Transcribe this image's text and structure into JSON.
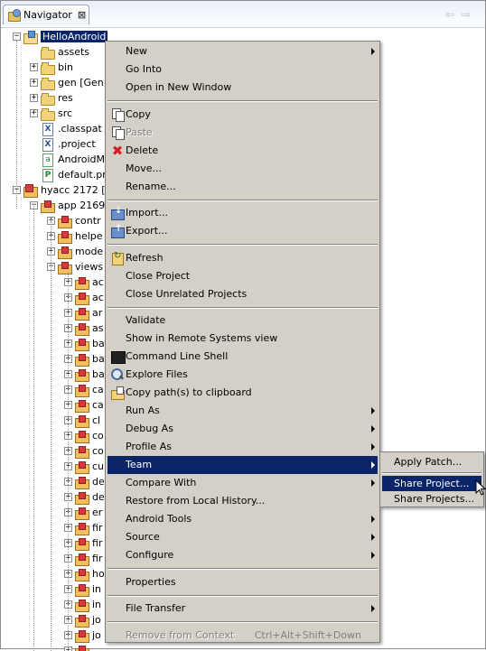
{
  "view": {
    "tab_label": "Navigator",
    "close_glyph": "⊠",
    "nav_arrows": "⇦⇨"
  },
  "tree": [
    {
      "label": "HelloAndroid",
      "icon": "proj",
      "level": 0,
      "toggle": "−",
      "selected": true
    },
    {
      "label": "assets",
      "icon": "folder",
      "level": 1,
      "toggle": ""
    },
    {
      "label": "bin",
      "icon": "folder",
      "level": 1,
      "toggle": "+"
    },
    {
      "label": "gen [Gen",
      "icon": "folder",
      "level": 1,
      "toggle": "+"
    },
    {
      "label": "res",
      "icon": "folder",
      "level": 1,
      "toggle": "+"
    },
    {
      "label": "src",
      "icon": "folder",
      "level": 1,
      "toggle": "+"
    },
    {
      "label": ".classpat",
      "icon": "xfile",
      "level": 1,
      "toggle": ""
    },
    {
      "label": ".project",
      "icon": "xfile",
      "level": 1,
      "toggle": ""
    },
    {
      "label": "AndroidM",
      "icon": "afile",
      "level": 1,
      "toggle": ""
    },
    {
      "label": "default.pr",
      "icon": "pfile",
      "level": 1,
      "toggle": ""
    },
    {
      "label": "hyacc 2172 [",
      "icon": "proj2",
      "level": 0,
      "toggle": "−"
    },
    {
      "label": "app 2169",
      "icon": "pkg",
      "level": 1,
      "toggle": "−"
    },
    {
      "label": "contr",
      "icon": "pkg",
      "level": 2,
      "toggle": "+"
    },
    {
      "label": "helpe",
      "icon": "pkg",
      "level": 2,
      "toggle": "+"
    },
    {
      "label": "mode",
      "icon": "pkg",
      "level": 2,
      "toggle": "+"
    },
    {
      "label": "views",
      "icon": "pkg",
      "level": 2,
      "toggle": "−"
    },
    {
      "label": "ac",
      "icon": "pkg",
      "level": 3,
      "toggle": "+"
    },
    {
      "label": "ac",
      "icon": "pkg",
      "level": 3,
      "toggle": "+"
    },
    {
      "label": "ar",
      "icon": "pkg",
      "level": 3,
      "toggle": "+"
    },
    {
      "label": "as",
      "icon": "pkg",
      "level": 3,
      "toggle": "+"
    },
    {
      "label": "ba",
      "icon": "pkg",
      "level": 3,
      "toggle": "+"
    },
    {
      "label": "ba",
      "icon": "pkg",
      "level": 3,
      "toggle": "+"
    },
    {
      "label": "ba",
      "icon": "pkg",
      "level": 3,
      "toggle": "+"
    },
    {
      "label": "ca",
      "icon": "pkg",
      "level": 3,
      "toggle": "+"
    },
    {
      "label": "ca",
      "icon": "pkg",
      "level": 3,
      "toggle": "+"
    },
    {
      "label": "cl",
      "icon": "pkg",
      "level": 3,
      "toggle": "+"
    },
    {
      "label": "co",
      "icon": "pkg",
      "level": 3,
      "toggle": "+"
    },
    {
      "label": "co",
      "icon": "pkg",
      "level": 3,
      "toggle": "+"
    },
    {
      "label": "cu",
      "icon": "pkg",
      "level": 3,
      "toggle": "+"
    },
    {
      "label": "de",
      "icon": "pkg",
      "level": 3,
      "toggle": "+"
    },
    {
      "label": "de",
      "icon": "pkg",
      "level": 3,
      "toggle": "+"
    },
    {
      "label": "er",
      "icon": "pkg",
      "level": 3,
      "toggle": "+"
    },
    {
      "label": "fir",
      "icon": "pkg",
      "level": 3,
      "toggle": "+"
    },
    {
      "label": "fir",
      "icon": "pkg",
      "level": 3,
      "toggle": "+"
    },
    {
      "label": "fir",
      "icon": "pkg",
      "level": 3,
      "toggle": "+"
    },
    {
      "label": "ho",
      "icon": "pkg",
      "level": 3,
      "toggle": "+"
    },
    {
      "label": "in",
      "icon": "pkg",
      "level": 3,
      "toggle": "+"
    },
    {
      "label": "in",
      "icon": "pkg",
      "level": 3,
      "toggle": "+"
    },
    {
      "label": "jo",
      "icon": "pkg",
      "level": 3,
      "toggle": "+"
    },
    {
      "label": "jo",
      "icon": "pkg",
      "level": 3,
      "toggle": "+"
    },
    {
      "label": "",
      "icon": "pkg",
      "level": 3,
      "toggle": "+"
    }
  ],
  "menu": [
    {
      "type": "item",
      "label": "New",
      "submenu": true,
      "name": "new"
    },
    {
      "type": "item",
      "label": "Go Into",
      "name": "go-into"
    },
    {
      "type": "item",
      "label": "Open in New Window",
      "name": "open-in-new-window"
    },
    {
      "type": "sep"
    },
    {
      "type": "item",
      "label": "Copy",
      "icon": "copy",
      "name": "copy"
    },
    {
      "type": "item",
      "label": "Paste",
      "disabled": true,
      "icon": "copy",
      "name": "paste"
    },
    {
      "type": "item",
      "label": "Delete",
      "icon": "del",
      "name": "delete"
    },
    {
      "type": "item",
      "label": "Move...",
      "name": "move"
    },
    {
      "type": "item",
      "label": "Rename...",
      "name": "rename"
    },
    {
      "type": "sep"
    },
    {
      "type": "item",
      "label": "Import...",
      "icon": "import",
      "name": "import"
    },
    {
      "type": "item",
      "label": "Export...",
      "icon": "export",
      "name": "export"
    },
    {
      "type": "sep"
    },
    {
      "type": "item",
      "label": "Refresh",
      "icon": "refresh",
      "name": "refresh"
    },
    {
      "type": "item",
      "label": "Close Project",
      "name": "close-project"
    },
    {
      "type": "item",
      "label": "Close Unrelated Projects",
      "name": "close-unrelated-projects"
    },
    {
      "type": "sep"
    },
    {
      "type": "item",
      "label": "Validate",
      "name": "validate"
    },
    {
      "type": "item",
      "label": "Show in Remote Systems view",
      "name": "show-in-remote-systems-view"
    },
    {
      "type": "item",
      "label": "Command Line Shell",
      "icon": "shell",
      "name": "command-line-shell"
    },
    {
      "type": "item",
      "label": "Explore Files",
      "icon": "explore",
      "name": "explore-files"
    },
    {
      "type": "item",
      "label": "Copy path(s) to clipboard",
      "icon": "copypath",
      "name": "copy-paths-to-clipboard"
    },
    {
      "type": "item",
      "label": "Run As",
      "submenu": true,
      "name": "run-as"
    },
    {
      "type": "item",
      "label": "Debug As",
      "submenu": true,
      "name": "debug-as"
    },
    {
      "type": "item",
      "label": "Profile As",
      "submenu": true,
      "name": "profile-as"
    },
    {
      "type": "item",
      "label": "Team",
      "submenu": true,
      "highlighted": true,
      "name": "team"
    },
    {
      "type": "item",
      "label": "Compare With",
      "submenu": true,
      "name": "compare-with"
    },
    {
      "type": "item",
      "label": "Restore from Local History...",
      "name": "restore-from-local-history"
    },
    {
      "type": "item",
      "label": "Android Tools",
      "submenu": true,
      "name": "android-tools"
    },
    {
      "type": "item",
      "label": "Source",
      "submenu": true,
      "name": "source"
    },
    {
      "type": "item",
      "label": "Configure",
      "submenu": true,
      "name": "configure"
    },
    {
      "type": "sep"
    },
    {
      "type": "item",
      "label": "Properties",
      "name": "properties"
    },
    {
      "type": "sep"
    },
    {
      "type": "item",
      "label": "File Transfer",
      "submenu": true,
      "name": "file-transfer"
    },
    {
      "type": "sep"
    },
    {
      "type": "item",
      "label": "Remove from Context",
      "shortcut": "Ctrl+Alt+Shift+Down",
      "disabled": true,
      "name": "remove-from-context"
    }
  ],
  "submenu_team": [
    {
      "label": "Apply Patch...",
      "name": "apply-patch"
    },
    {
      "type": "sep"
    },
    {
      "label": "Share Project...",
      "highlighted": true,
      "name": "share-project"
    },
    {
      "label": "Share Projects...",
      "name": "share-projects"
    }
  ],
  "colors": {
    "selection": "#0a246a",
    "menu_bg": "#d4d0c8",
    "delete_icon": "#d02020"
  }
}
